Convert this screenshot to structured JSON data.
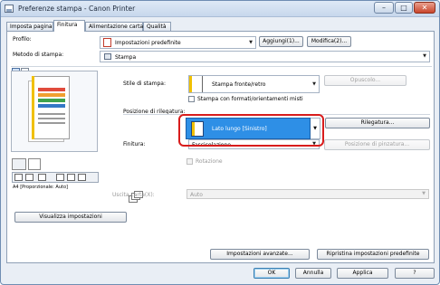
{
  "window": {
    "title": "Preferenze stampa - Canon Printer",
    "minimize": "–",
    "maximize": "□",
    "close": "✕"
  },
  "tabs": [
    {
      "label": "Imposta pagina",
      "active": false
    },
    {
      "label": "Finitura",
      "active": true
    },
    {
      "label": "Alimentazione carta",
      "active": false
    },
    {
      "label": "Qualità",
      "active": false
    }
  ],
  "profile": {
    "label": "Profilo:",
    "value": "Impostazioni predefinite",
    "add_button": "Aggiungi(1)...",
    "edit_button": "Modifica(2)..."
  },
  "output_method": {
    "label": "Metodo di stampa:",
    "value": "Stampa"
  },
  "preview": {
    "caption": "A4 [Proporzionale: Auto]"
  },
  "print_style": {
    "label": "Stile di stampa:",
    "value": "Stampa fronte/retro",
    "options_button": "Opuscolo...",
    "mixed_formats_checkbox": "Stampa con formati/orientamenti misti"
  },
  "binding_location": {
    "label": "Posizione di rilegatura:",
    "value": "Lato lungo [Sinistro]",
    "button": "Rilegatura..."
  },
  "finishing": {
    "label": "Finitura:",
    "value": "Fascicolazione",
    "staple_button": "Posizione di pinzatura...",
    "rotate_checkbox": "Rotazione"
  },
  "paper_output": {
    "label": "Uscita carta(X):",
    "value": "Auto"
  },
  "view_settings_button": "Visualizza impostazioni",
  "advanced_button": "Impostazioni avanzate...",
  "restore_button": "Ripristina impostazioni predefinite",
  "dialog_buttons": {
    "ok": "OK",
    "cancel": "Annulla",
    "apply": "Applica",
    "help": "?"
  },
  "colors": {
    "accent": "#2e8fe6",
    "highlight_border": "#d81c1c",
    "binding_strip": "#f0c000"
  }
}
